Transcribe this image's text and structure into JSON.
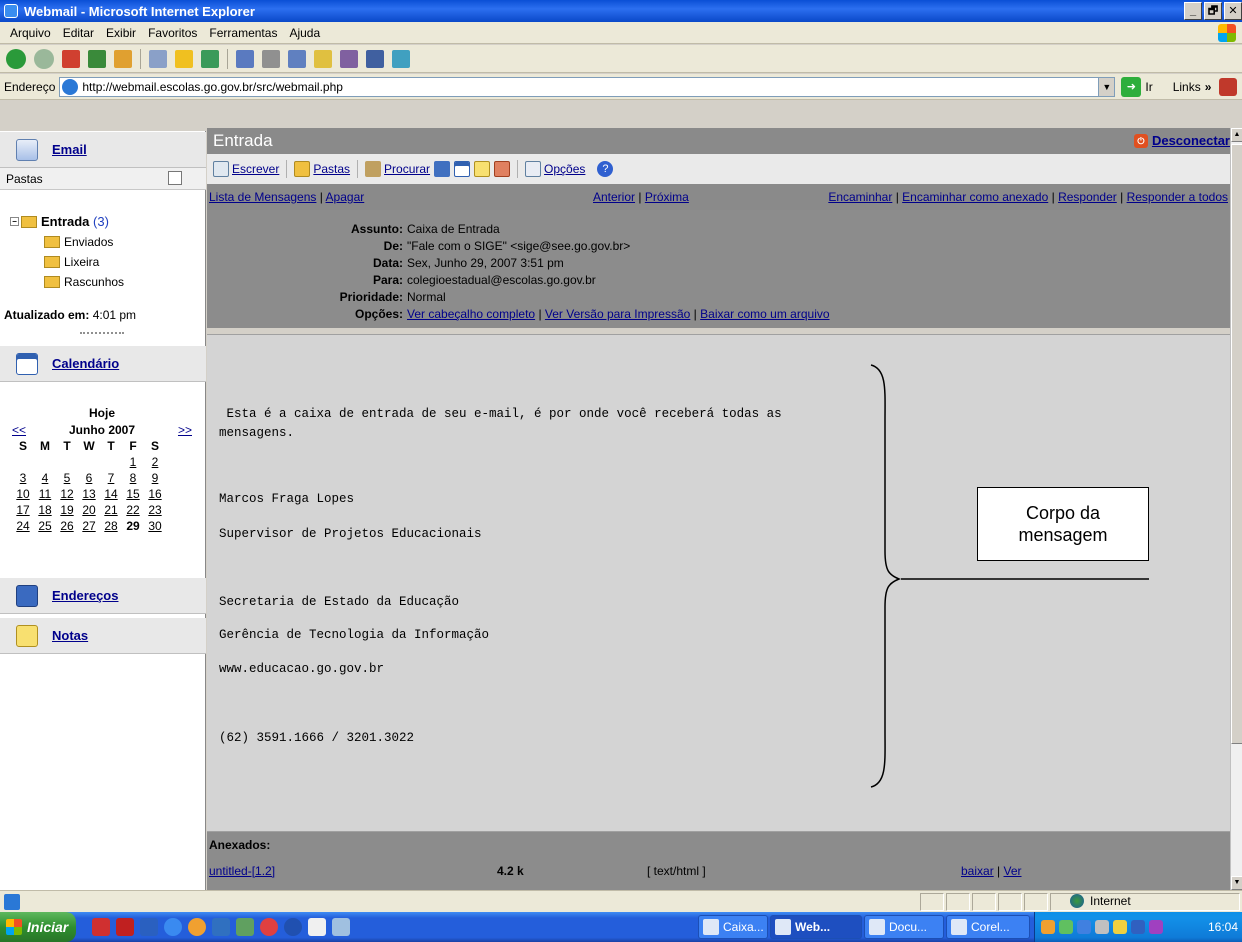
{
  "window": {
    "title": "Webmail - Microsoft Internet Explorer",
    "controls": [
      "_",
      "🗗",
      "✕"
    ]
  },
  "menu": [
    "Arquivo",
    "Editar",
    "Exibir",
    "Favoritos",
    "Ferramentas",
    "Ajuda"
  ],
  "address": {
    "label": "Endereço",
    "url": "http://webmail.escolas.go.gov.br/src/webmail.php",
    "go": "Ir",
    "links": "Links",
    "links_chevron": "»"
  },
  "sidebar": {
    "email_label": "Email",
    "pastas_label": "Pastas",
    "folders": {
      "inbox": "Entrada",
      "inbox_count": "(3)",
      "sent": "Enviados",
      "trash": "Lixeira",
      "drafts": "Rascunhos"
    },
    "updated_label": "Atualizado em:",
    "updated_time": "4:01 pm",
    "calendar_label": "Calendário",
    "addresses_label": "Endereços",
    "notes_label": "Notas"
  },
  "calendar": {
    "today_label": "Hoje",
    "prev": "<<",
    "next": ">>",
    "month": "Junho 2007",
    "weekdays": [
      "S",
      "M",
      "T",
      "W",
      "T",
      "F",
      "S"
    ],
    "weeks": [
      [
        "",
        "",
        "",
        "",
        "",
        "1",
        "2"
      ],
      [
        "3",
        "4",
        "5",
        "6",
        "7",
        "8",
        "9"
      ],
      [
        "10",
        "11",
        "12",
        "13",
        "14",
        "15",
        "16"
      ],
      [
        "17",
        "18",
        "19",
        "20",
        "21",
        "22",
        "23"
      ],
      [
        "24",
        "25",
        "26",
        "27",
        "28",
        "29",
        "30"
      ]
    ],
    "today_day": "29"
  },
  "main": {
    "title": "Entrada",
    "logout": "Desconectar",
    "toolbar": {
      "compose": "Escrever",
      "folders": "Pastas",
      "search": "Procurar",
      "options": "Opções"
    },
    "actions": {
      "list": "Lista de Mensagens",
      "delete": "Apagar",
      "previous": "Anterior",
      "next": "Próxima",
      "forward": "Encaminhar",
      "forward_attach": "Encaminhar como anexado",
      "reply": "Responder",
      "reply_all": "Responder a todos",
      "sep": "|"
    },
    "headers": {
      "subject_label": "Assunto:",
      "subject": "Caixa de Entrada",
      "from_label": "De:",
      "from": "\"Fale com o SIGE\" <sige@see.go.gov.br>",
      "date_label": "Data:",
      "date": "Sex, Junho 29, 2007 3:51 pm",
      "to_label": "Para:",
      "to": "colegioestadual@escolas.go.gov.br",
      "priority_label": "Prioridade:",
      "priority": "Normal",
      "options_label": "Opções:",
      "full_headers": "Ver cabeçalho completo",
      "print_version": "Ver Versão para Impressão",
      "download_file": "Baixar como um arquivo"
    },
    "body": {
      "line1": " Esta é a caixa de entrada de seu e-mail, é por onde você receberá todas as",
      "line2": "mensagens.",
      "line3": "Marcos Fraga Lopes",
      "line4": "Supervisor de Projetos Educacionais",
      "line5": "Secretaria de Estado da Educação",
      "line6": "Gerência de Tecnologia da Informação",
      "line7": "www.educacao.go.gov.br",
      "line8": "(62) 3591.1666 / 3201.3022"
    },
    "annotation": "Corpo da mensagem",
    "attachments": {
      "title": "Anexados:",
      "name": "untitled-[1.2]",
      "size": "4.2 k",
      "type": "[ text/html ]",
      "download": "baixar",
      "view": "Ver"
    }
  },
  "statusbar": {
    "zone": "Internet"
  },
  "taskbar": {
    "start": "Iniciar",
    "tasks": [
      "Caixa...",
      "Web...",
      "Docu...",
      "Corel..."
    ],
    "clock": "16:04"
  }
}
